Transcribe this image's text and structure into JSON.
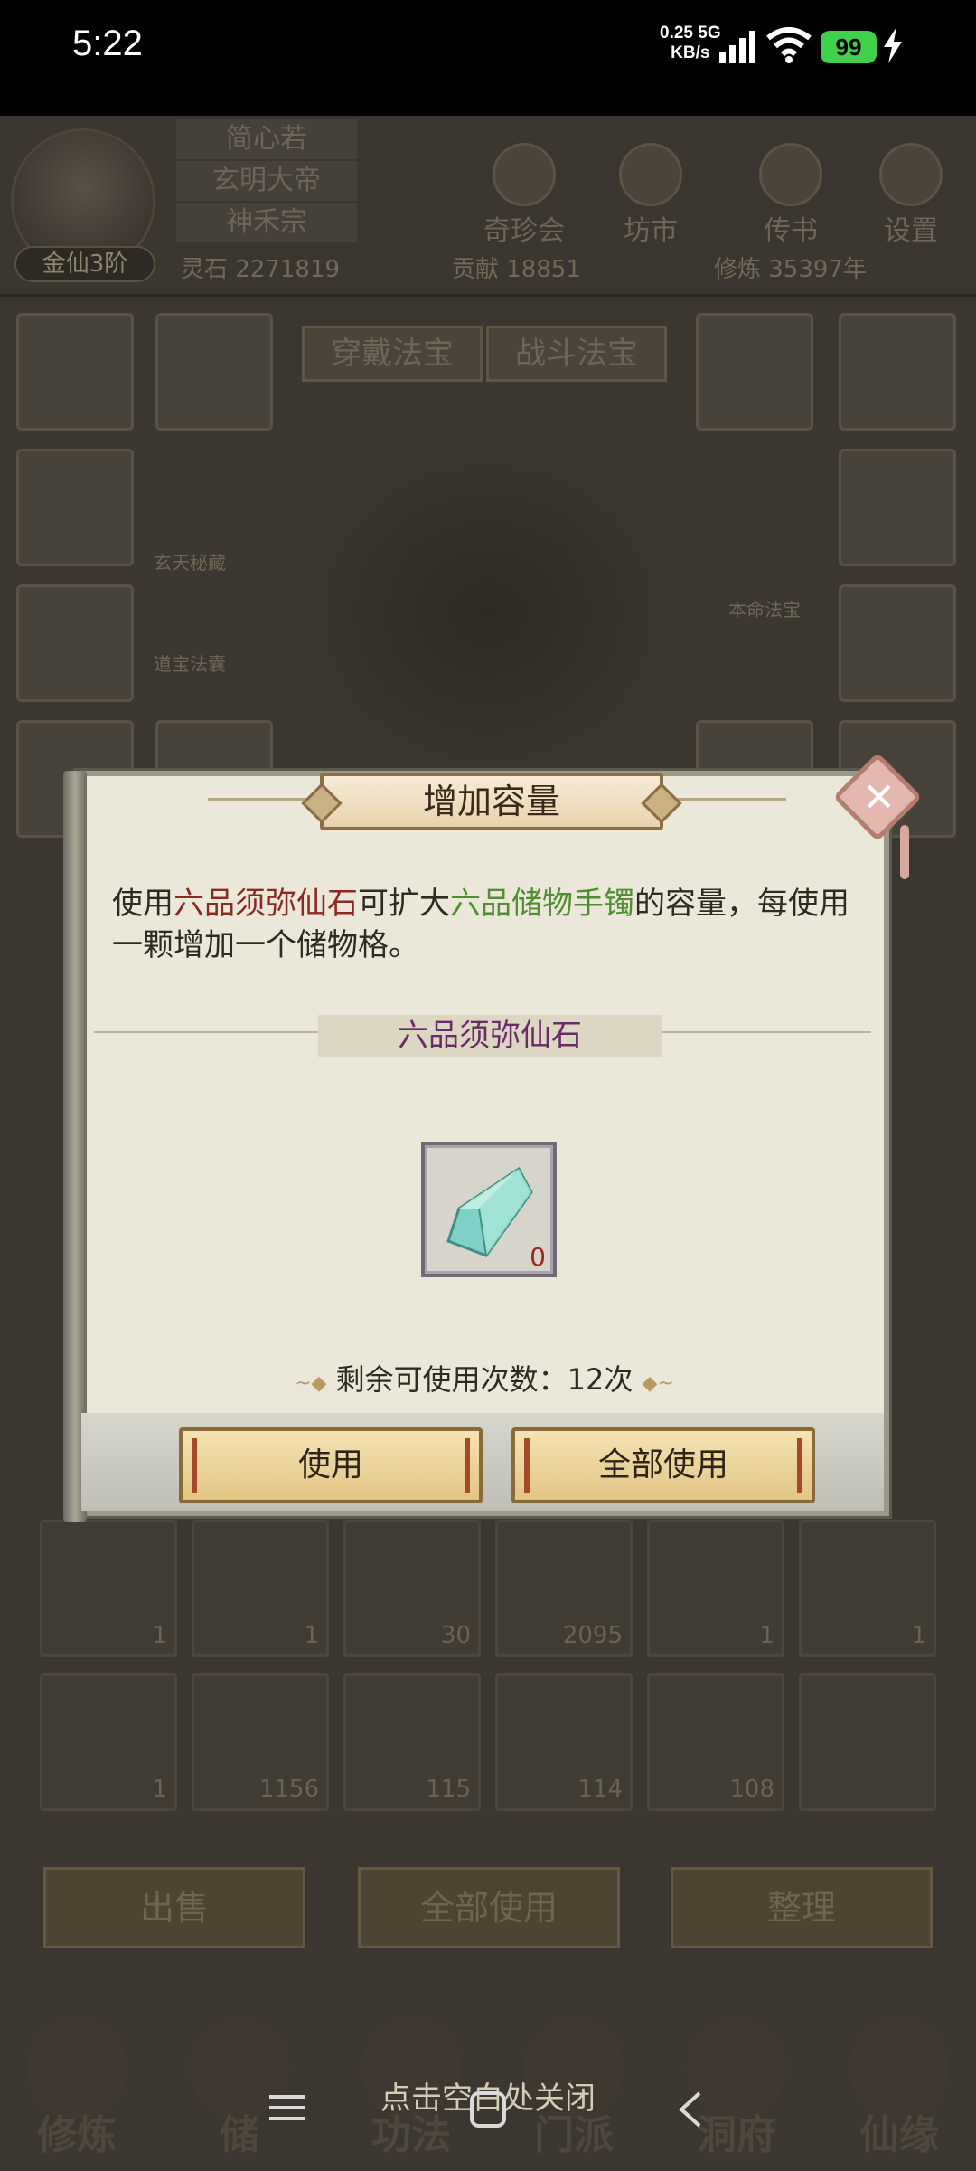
{
  "status_bar": {
    "time": "5:22",
    "net_speed": "0.25",
    "net_unit": "KB/s",
    "net_type": "5G",
    "battery": "99",
    "icons": [
      "signal-icon",
      "wifi-icon",
      "battery-icon",
      "charging-icon"
    ]
  },
  "player": {
    "names": [
      "简心若",
      "玄明大帝",
      "神禾宗"
    ],
    "rank": "金仙3阶"
  },
  "top_menu": [
    {
      "label": "奇珍会",
      "icon": "pavilion-icon"
    },
    {
      "label": "坊市",
      "icon": "shop-icon"
    },
    {
      "label": "传书",
      "icon": "bee-icon"
    },
    {
      "label": "设置",
      "icon": "gear-icon"
    }
  ],
  "resources": {
    "spirit_stone": "灵石 2271819",
    "contribution": "贡献 18851",
    "cultivation": "修炼 35397年"
  },
  "equip_tabs": [
    "穿戴法宝",
    "战斗法宝"
  ],
  "side_labels": [
    "玄天秘藏",
    "道宝法囊",
    "本命法宝"
  ],
  "inventory_counts": [
    "1",
    "1",
    "30",
    "2095",
    "1",
    "1",
    "1",
    "1156",
    "115",
    "114",
    "108"
  ],
  "bottom_actions": [
    "出售",
    "全部使用",
    "整理"
  ],
  "bottom_nav": [
    "修炼",
    "储",
    "功法",
    "门派",
    "洞府",
    "仙缘"
  ],
  "close_hint": "点击空白处关闭",
  "dialog": {
    "title": "增加容量",
    "desc_1": "使用",
    "desc_item": "六品须弥仙石",
    "desc_2": "可扩大",
    "desc_target": "六品储物手镯",
    "desc_3": "的容量，每使用一颗增加一个储物格。",
    "section_label": "六品须弥仙石",
    "item_count": "0",
    "remaining": "剩余可使用次数：12次",
    "use_button": "使用",
    "use_all_button": "全部使用"
  },
  "colors": {
    "dim_bg": "#3b3730",
    "dialog_bg": "#ece8d9",
    "item_red": "#8a2a22",
    "item_green": "#4f8f32",
    "section_purple": "#6b2a6a",
    "button_gold": "#e9d29a"
  }
}
